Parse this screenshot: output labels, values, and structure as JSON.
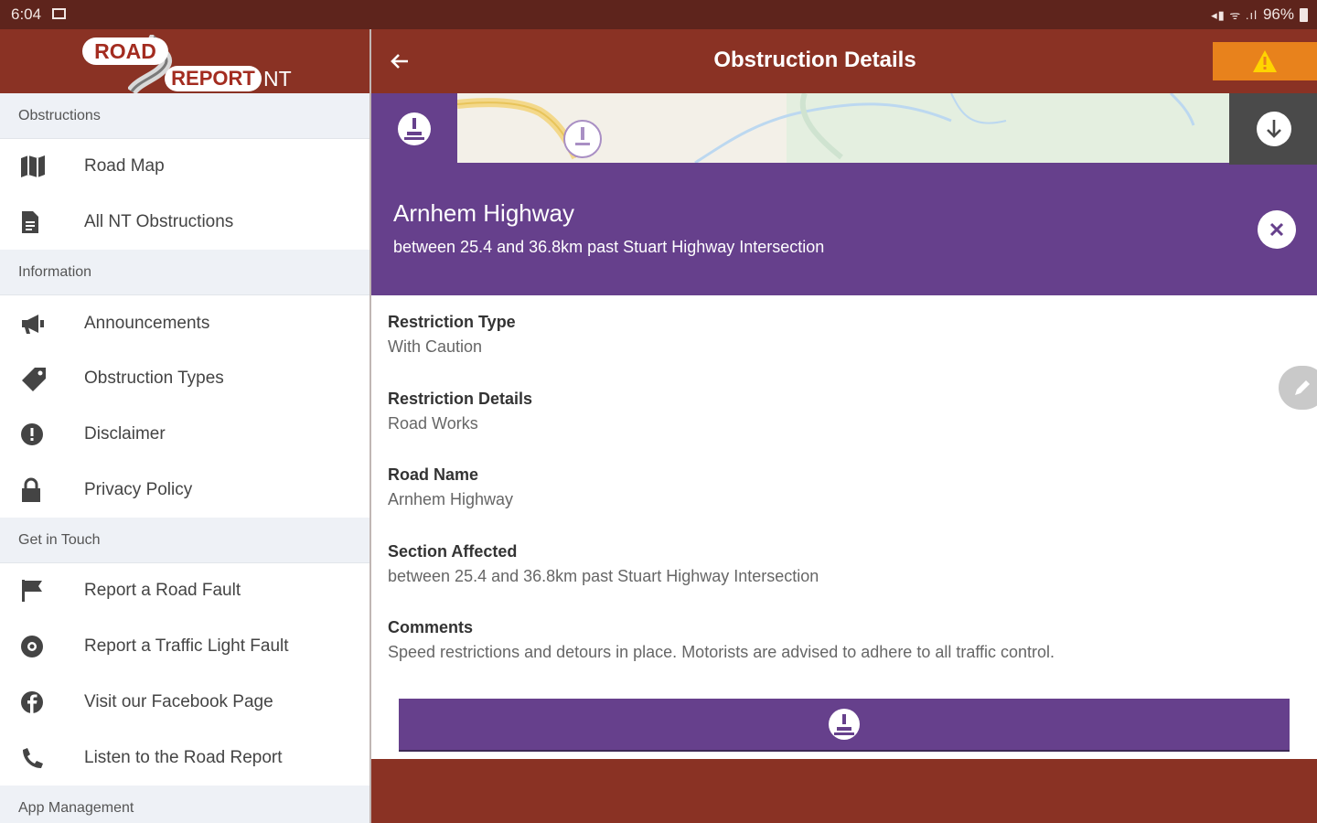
{
  "status_bar": {
    "time": "6:04",
    "battery": "96%"
  },
  "drawer": {
    "logo": {
      "line1": "ROAD",
      "line2": "REPORT",
      "suffix": "NT"
    },
    "sections": [
      {
        "header": "Obstructions",
        "items": [
          {
            "label": "Road Map",
            "icon": "map-icon"
          },
          {
            "label": "All NT Obstructions",
            "icon": "document-icon"
          }
        ]
      },
      {
        "header": "Information",
        "items": [
          {
            "label": "Announcements",
            "icon": "megaphone-icon"
          },
          {
            "label": "Obstruction Types",
            "icon": "tag-icon"
          },
          {
            "label": "Disclaimer",
            "icon": "alert-circle-icon"
          },
          {
            "label": "Privacy Policy",
            "icon": "lock-icon"
          }
        ]
      },
      {
        "header": "Get in Touch",
        "items": [
          {
            "label": "Report a Road Fault",
            "icon": "flag-icon"
          },
          {
            "label": "Report a Traffic Light Fault",
            "icon": "traffic-light-icon"
          },
          {
            "label": "Visit our Facebook Page",
            "icon": "facebook-icon"
          },
          {
            "label": "Listen to the Road Report",
            "icon": "phone-icon"
          }
        ]
      },
      {
        "header": "App Management",
        "items": []
      }
    ]
  },
  "main": {
    "title": "Obstruction Details",
    "road": {
      "name": "Arnhem Highway",
      "section": "between 25.4 and 36.8km past Stuart Highway Intersection"
    },
    "fields": [
      {
        "label": "Restriction Type",
        "value": "With Caution"
      },
      {
        "label": "Restriction Details",
        "value": "Road Works"
      },
      {
        "label": "Road Name",
        "value": "Arnhem Highway"
      },
      {
        "label": "Section Affected",
        "value": "between 25.4 and 36.8km past Stuart Highway Intersection"
      },
      {
        "label": "Comments",
        "value": "Speed restrictions and detours in place. Motorists are advised to adhere to all traffic control."
      }
    ]
  },
  "colors": {
    "brand_red": "#8a3224",
    "status_bar": "#5e241c",
    "purple": "#66408c",
    "warning_orange": "#e8821c"
  }
}
